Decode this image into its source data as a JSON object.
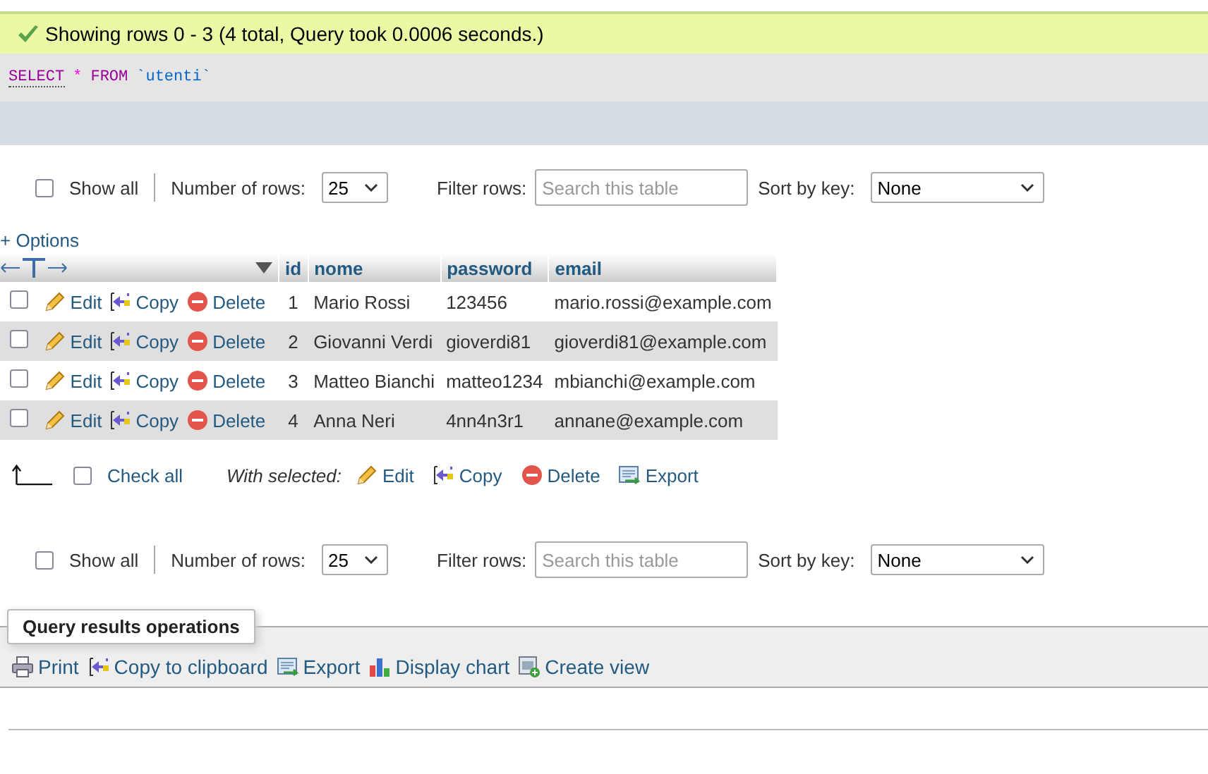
{
  "message": {
    "text": "Showing rows 0 - 3 (4 total, Query took 0.0006 seconds.)"
  },
  "sql": {
    "keyword_select": "SELECT",
    "star": "*",
    "keyword_from": "FROM",
    "table": "`utenti`"
  },
  "navs": [
    {
      "show_all": "Show all",
      "checked": false,
      "rows_label": "Number of rows:",
      "rows_value": "25",
      "filter_label": "Filter rows:",
      "filter_placeholder": "Search this table",
      "sort_label": "Sort by key:",
      "sort_value": "None"
    },
    {
      "show_all": "Show all",
      "checked": false,
      "rows_label": "Number of rows:",
      "rows_value": "25",
      "filter_label": "Filter rows:",
      "filter_placeholder": "Search this table",
      "sort_label": "Sort by key:",
      "sort_value": "None"
    }
  ],
  "options_link": "+ Options",
  "columns": [
    "id",
    "nome",
    "password",
    "email"
  ],
  "rows": [
    {
      "checked": false,
      "actions": [
        {
          "kind": "edit",
          "label": "Edit"
        },
        {
          "kind": "copy",
          "label": "Copy"
        },
        {
          "kind": "delete",
          "label": "Delete"
        }
      ],
      "cells": [
        "1",
        "Mario Rossi",
        "123456",
        "mario.rossi@example.com"
      ]
    },
    {
      "checked": false,
      "actions": [
        {
          "kind": "edit",
          "label": "Edit"
        },
        {
          "kind": "copy",
          "label": "Copy"
        },
        {
          "kind": "delete",
          "label": "Delete"
        }
      ],
      "cells": [
        "2",
        "Giovanni Verdi",
        "gioverdi81",
        "gioverdi81@example.com"
      ]
    },
    {
      "checked": false,
      "actions": [
        {
          "kind": "edit",
          "label": "Edit"
        },
        {
          "kind": "copy",
          "label": "Copy"
        },
        {
          "kind": "delete",
          "label": "Delete"
        }
      ],
      "cells": [
        "3",
        "Matteo Bianchi",
        "matteo1234",
        "mbianchi@example.com"
      ]
    },
    {
      "checked": false,
      "actions": [
        {
          "kind": "edit",
          "label": "Edit"
        },
        {
          "kind": "copy",
          "label": "Copy"
        },
        {
          "kind": "delete",
          "label": "Delete"
        }
      ],
      "cells": [
        "4",
        "Anna Neri",
        "4nn4n3r1",
        "annane@example.com"
      ]
    }
  ],
  "bulk": {
    "check_all": "Check all",
    "checked": false,
    "with_selected": "With selected:",
    "actions": [
      {
        "kind": "edit",
        "label": "Edit"
      },
      {
        "kind": "copy",
        "label": "Copy"
      },
      {
        "kind": "delete",
        "label": "Delete"
      },
      {
        "kind": "export",
        "label": "Export"
      }
    ]
  },
  "operations": {
    "legend": "Query results operations",
    "items": [
      {
        "kind": "print",
        "label": "Print"
      },
      {
        "kind": "copy",
        "label": "Copy to clipboard"
      },
      {
        "kind": "export",
        "label": "Export"
      },
      {
        "kind": "chart",
        "label": "Display chart"
      },
      {
        "kind": "view",
        "label": "Create view"
      }
    ]
  }
}
